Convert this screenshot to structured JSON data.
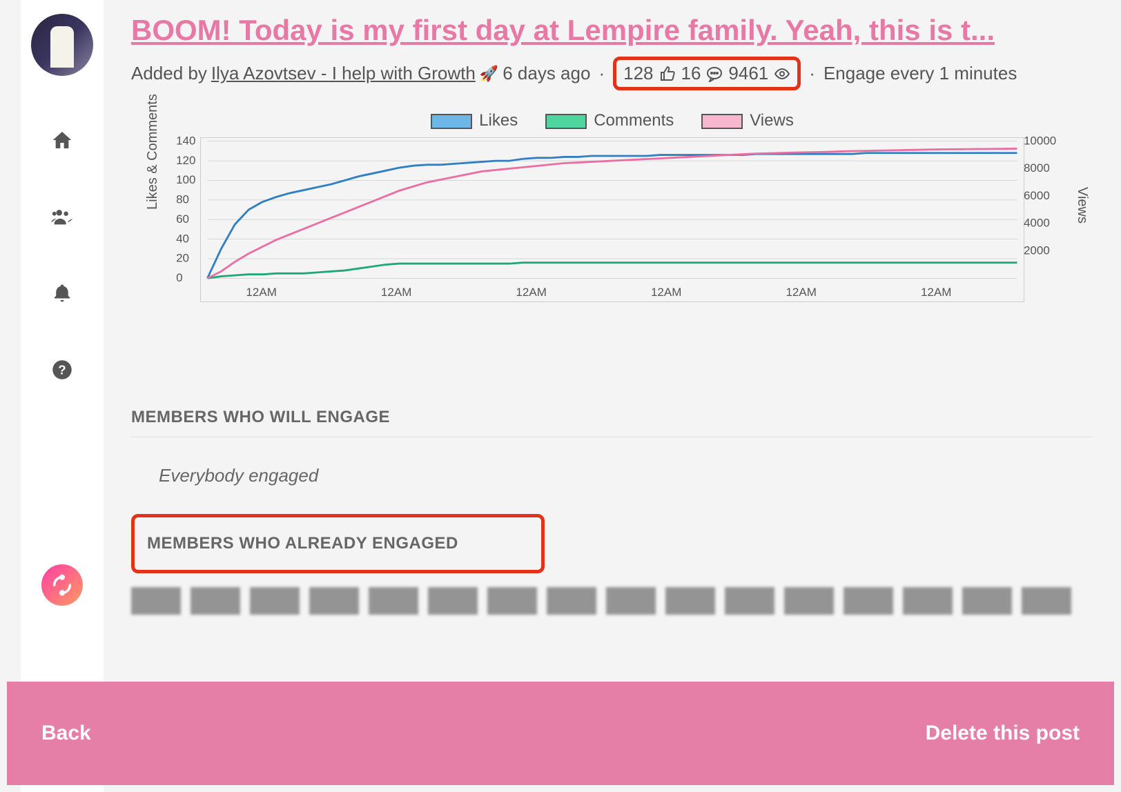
{
  "post": {
    "title": "BOOM! Today is my first day at Lempire family. Yeah, this is t...",
    "added_by_prefix": "Added by",
    "author": "Ilya Azovtsev - I help with Growth",
    "rocket": "🚀",
    "age": "6 days ago",
    "likes": "128",
    "comments": "16",
    "views": "9461",
    "engage_text": "Engage every 1 minutes"
  },
  "legend": {
    "likes": "Likes",
    "comments": "Comments",
    "views": "Views"
  },
  "axes": {
    "y_left_label": "Likes & Comments",
    "y_right_label": "Views",
    "y_left_ticks": [
      "0",
      "20",
      "40",
      "60",
      "80",
      "100",
      "120",
      "140"
    ],
    "y_right_ticks": [
      "2000",
      "4000",
      "6000",
      "8000",
      "10000"
    ],
    "x_ticks": [
      "12AM",
      "12AM",
      "12AM",
      "12AM",
      "12AM",
      "12AM"
    ]
  },
  "sections": {
    "will_engage_title": "MEMBERS WHO WILL ENGAGE",
    "will_engage_empty": "Everybody engaged",
    "already_engaged_title": "MEMBERS WHO ALREADY ENGAGED"
  },
  "footer": {
    "back": "Back",
    "delete": "Delete this post"
  },
  "chart_data": {
    "type": "line",
    "title": "",
    "xlabel": "",
    "ylabel_left": "Likes & Comments",
    "ylabel_right": "Views",
    "y_left_range": [
      0,
      140
    ],
    "y_right_range": [
      0,
      10000
    ],
    "x": [
      0,
      1,
      2,
      3,
      4,
      5,
      6,
      7,
      8,
      9,
      10,
      11,
      12,
      13,
      14,
      15,
      16,
      17,
      18,
      19,
      20,
      21,
      22,
      23,
      24,
      25,
      26,
      27,
      28,
      29,
      30,
      31,
      32,
      33,
      34,
      35,
      36,
      37,
      38,
      39,
      40,
      41,
      42,
      43,
      44,
      45,
      46,
      47,
      48,
      49,
      50,
      51,
      52,
      53,
      54,
      55,
      56,
      57,
      58,
      59
    ],
    "x_tick_labels": [
      "12AM",
      "12AM",
      "12AM",
      "12AM",
      "12AM",
      "12AM"
    ],
    "series": [
      {
        "name": "Likes",
        "axis": "left",
        "color": "#2f7fc2",
        "values": [
          0,
          30,
          55,
          70,
          78,
          83,
          87,
          90,
          93,
          96,
          100,
          104,
          107,
          110,
          113,
          115,
          116,
          116,
          117,
          118,
          119,
          120,
          120,
          122,
          123,
          123,
          124,
          124,
          125,
          125,
          125,
          125,
          125,
          126,
          126,
          126,
          126,
          126,
          126,
          126,
          127,
          127,
          127,
          127,
          127,
          127,
          127,
          127,
          128,
          128,
          128,
          128,
          128,
          128,
          128,
          128,
          128,
          128,
          128,
          128
        ]
      },
      {
        "name": "Comments",
        "axis": "left",
        "color": "#1fa776",
        "values": [
          0,
          2,
          3,
          4,
          4,
          5,
          5,
          5,
          6,
          7,
          8,
          10,
          12,
          14,
          15,
          15,
          15,
          15,
          15,
          15,
          15,
          15,
          15,
          16,
          16,
          16,
          16,
          16,
          16,
          16,
          16,
          16,
          16,
          16,
          16,
          16,
          16,
          16,
          16,
          16,
          16,
          16,
          16,
          16,
          16,
          16,
          16,
          16,
          16,
          16,
          16,
          16,
          16,
          16,
          16,
          16,
          16,
          16,
          16,
          16
        ]
      },
      {
        "name": "Views",
        "axis": "right",
        "color": "#e96fa3",
        "values": [
          0,
          500,
          1200,
          1800,
          2300,
          2800,
          3200,
          3600,
          4000,
          4400,
          4800,
          5200,
          5600,
          6000,
          6400,
          6700,
          7000,
          7200,
          7400,
          7600,
          7800,
          7900,
          8000,
          8100,
          8200,
          8300,
          8400,
          8450,
          8500,
          8550,
          8600,
          8650,
          8700,
          8750,
          8800,
          8850,
          8900,
          8950,
          9000,
          9050,
          9100,
          9120,
          9150,
          9180,
          9200,
          9220,
          9250,
          9280,
          9300,
          9320,
          9340,
          9360,
          9380,
          9400,
          9410,
          9420,
          9430,
          9440,
          9450,
          9461
        ]
      }
    ]
  }
}
